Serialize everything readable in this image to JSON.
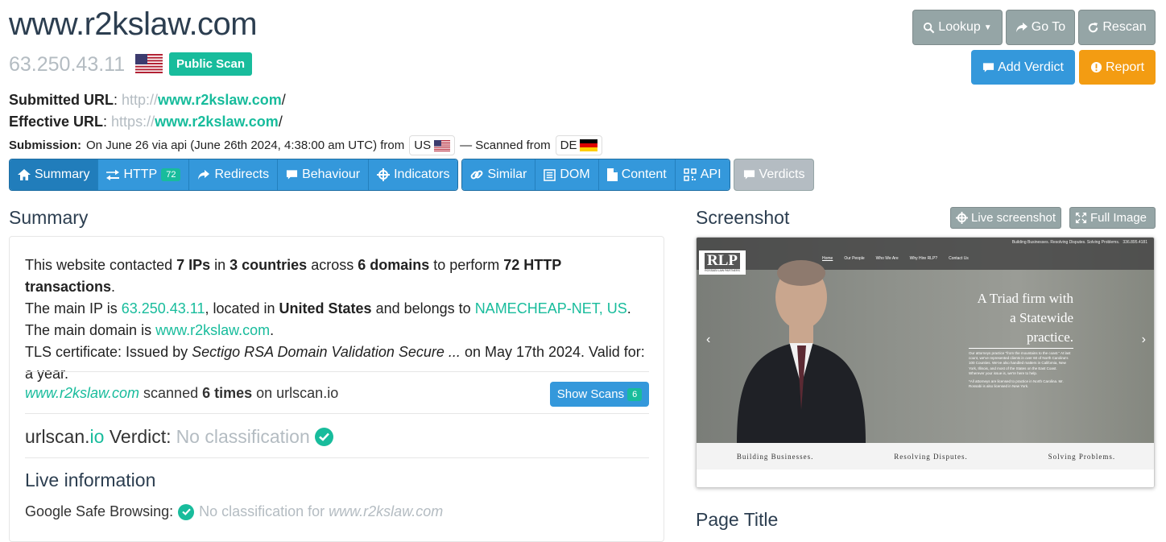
{
  "header": {
    "domain": "www.r2kslaw.com",
    "ip": "63.250.43.11",
    "public_scan": "Public Scan",
    "lookup": "Lookup",
    "goto": "Go To",
    "rescan": "Rescan",
    "add_verdict": "Add Verdict",
    "report": "Report"
  },
  "submitted": {
    "label": "Submitted URL",
    "scheme": "http://",
    "host": "www.r2kslaw.com",
    "path": "/"
  },
  "effective": {
    "label": "Effective URL",
    "scheme": "https://",
    "host": "www.r2kslaw.com",
    "path": "/"
  },
  "submission": {
    "label": "Submission:",
    "text": "On June 26 via api (June 26th 2024, 4:38:00 am UTC) from",
    "from_cc": "US",
    "scanned_from_text": "— Scanned from",
    "scanned_cc": "DE"
  },
  "tabs": {
    "summary": "Summary",
    "http": "HTTP",
    "http_count": "72",
    "redirects": "Redirects",
    "behaviour": "Behaviour",
    "indicators": "Indicators",
    "similar": "Similar",
    "dom": "DOM",
    "content": "Content",
    "api": "API",
    "verdicts": "Verdicts"
  },
  "summary": {
    "heading": "Summary",
    "t1": "This website contacted ",
    "ips": "7 IPs",
    "t2": " in ",
    "countries": "3 countries",
    "t3": " across ",
    "domains": "6 domains",
    "t4": " to perform ",
    "transactions": "72 HTTP transactions",
    "t5": ".",
    "main_ip_text": "The main IP is ",
    "main_ip": "63.250.43.11",
    "located_text": ", located in ",
    "country": "United States",
    "belongs_text": " and belongs to ",
    "asn": "NAMECHEAP-NET, US",
    "dot": ".",
    "main_domain_text": "The main domain is ",
    "main_domain": "www.r2kslaw.com",
    "tls_text": "TLS certificate: Issued by ",
    "tls_issuer": "Sectigo RSA Domain Validation Secure ...",
    "tls_rest": " on May 17th 2024. Valid for: a year.",
    "scanned_domain": "www.r2kslaw.com",
    "scanned_text1": " scanned ",
    "scanned_times": "6 times",
    "scanned_text2": " on urlscan.io",
    "show_scans": "Show Scans",
    "show_scans_count": "6",
    "verdict_prefix": "urlscan.",
    "verdict_io": "io",
    "verdict_label": " Verdict:",
    "verdict_value": "No classification",
    "live_info": "Live information",
    "gsb_label": "Google Safe Browsing:",
    "gsb_value": "No classification for ",
    "gsb_domain": "www.r2kslaw.com"
  },
  "screenshot": {
    "heading": "Screenshot",
    "live": "Live screenshot",
    "full": "Full Image",
    "site_tagline": "Building Businesses. Resolving Disputes. Solving Problems.",
    "phone": "336.895.4181",
    "logo": "RLP",
    "logo_sub": "ROSSABI LAW PARTNERS",
    "nav": [
      "Home",
      "Our People",
      "Who We Are",
      "Why Hire RLP?",
      "Contact Us"
    ],
    "hero_line1": "A Triad firm with",
    "hero_line2": "a Statewide",
    "hero_line3": "practice.",
    "hero_para": "Our attorneys practice \"from the mountains to the coast.\" At last count, we've represented clients in over 60 of North Carolina's 100 Counties. We've also handled matters in California, New York, Illinois, and most of the States on the East Coast. Wherever your issue is, we're here to help.",
    "hero_note": "*All attorneys are licensed to practice in North Carolina. Mr. Rossabi is also licensed in New York.",
    "band1": "Building Businesses.",
    "band2": "Resolving Disputes.",
    "band3": "Solving Problems."
  },
  "page_title": {
    "heading": "Page Title"
  }
}
